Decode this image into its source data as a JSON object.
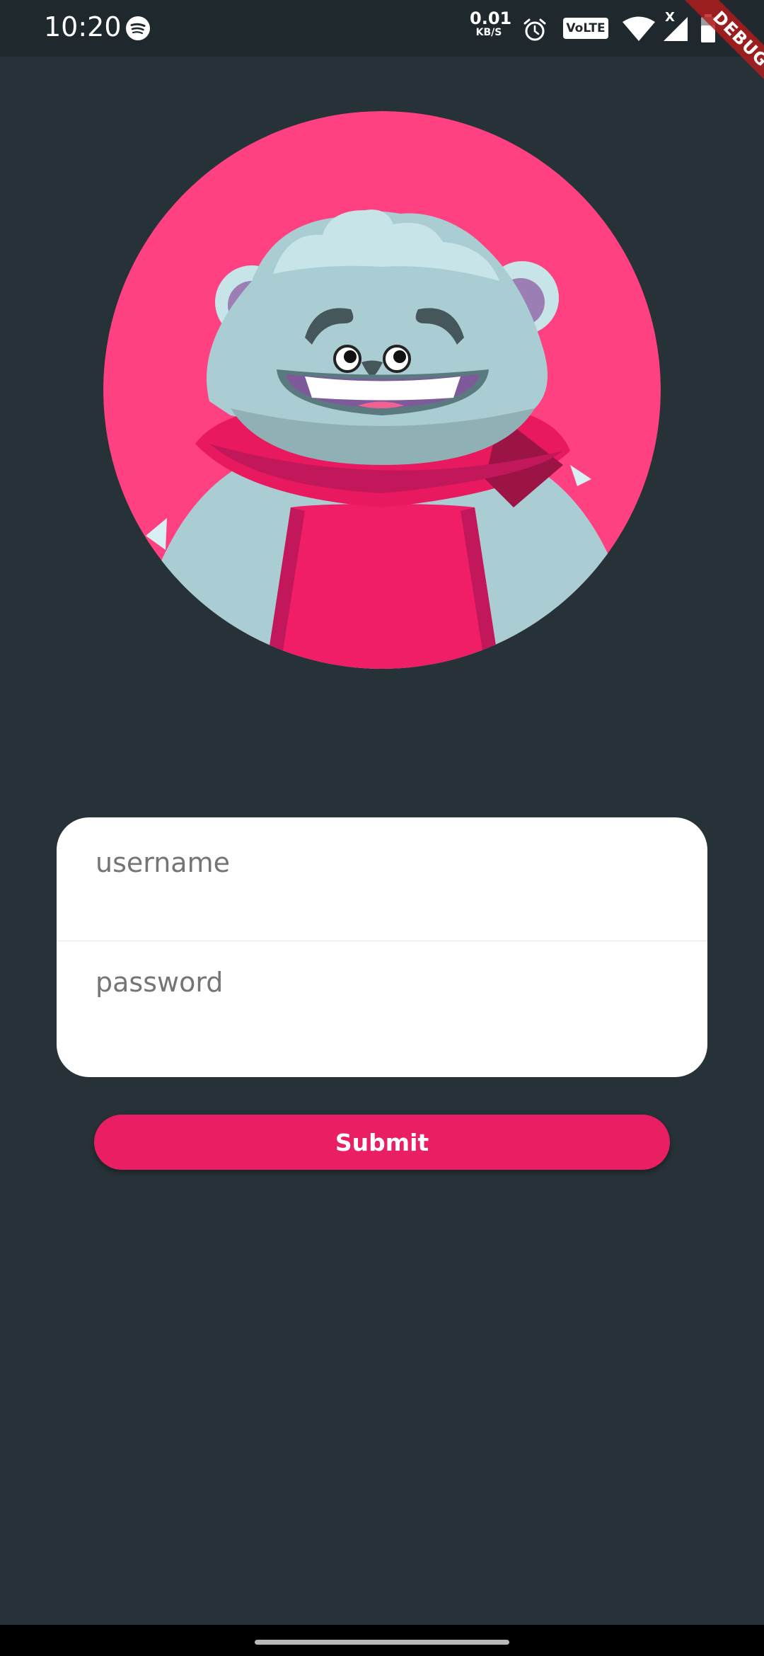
{
  "status_bar": {
    "time": "10:20",
    "net_speed_value": "0.01",
    "net_speed_unit": "KB/S",
    "volte_label": "VoLTE",
    "signal_label": "X",
    "icons": [
      "spotify-icon",
      "alarm-icon",
      "wifi-icon",
      "signal-icon",
      "battery-icon"
    ]
  },
  "debug_banner": {
    "label": "DEBUG"
  },
  "login": {
    "username_placeholder": "username",
    "username_value": "",
    "password_placeholder": "password",
    "password_value": "",
    "submit_label": "Submit"
  },
  "colors": {
    "background": "#263238",
    "avatar_background": "#ff4081",
    "accent": "#e91e63",
    "card": "#ffffff"
  }
}
